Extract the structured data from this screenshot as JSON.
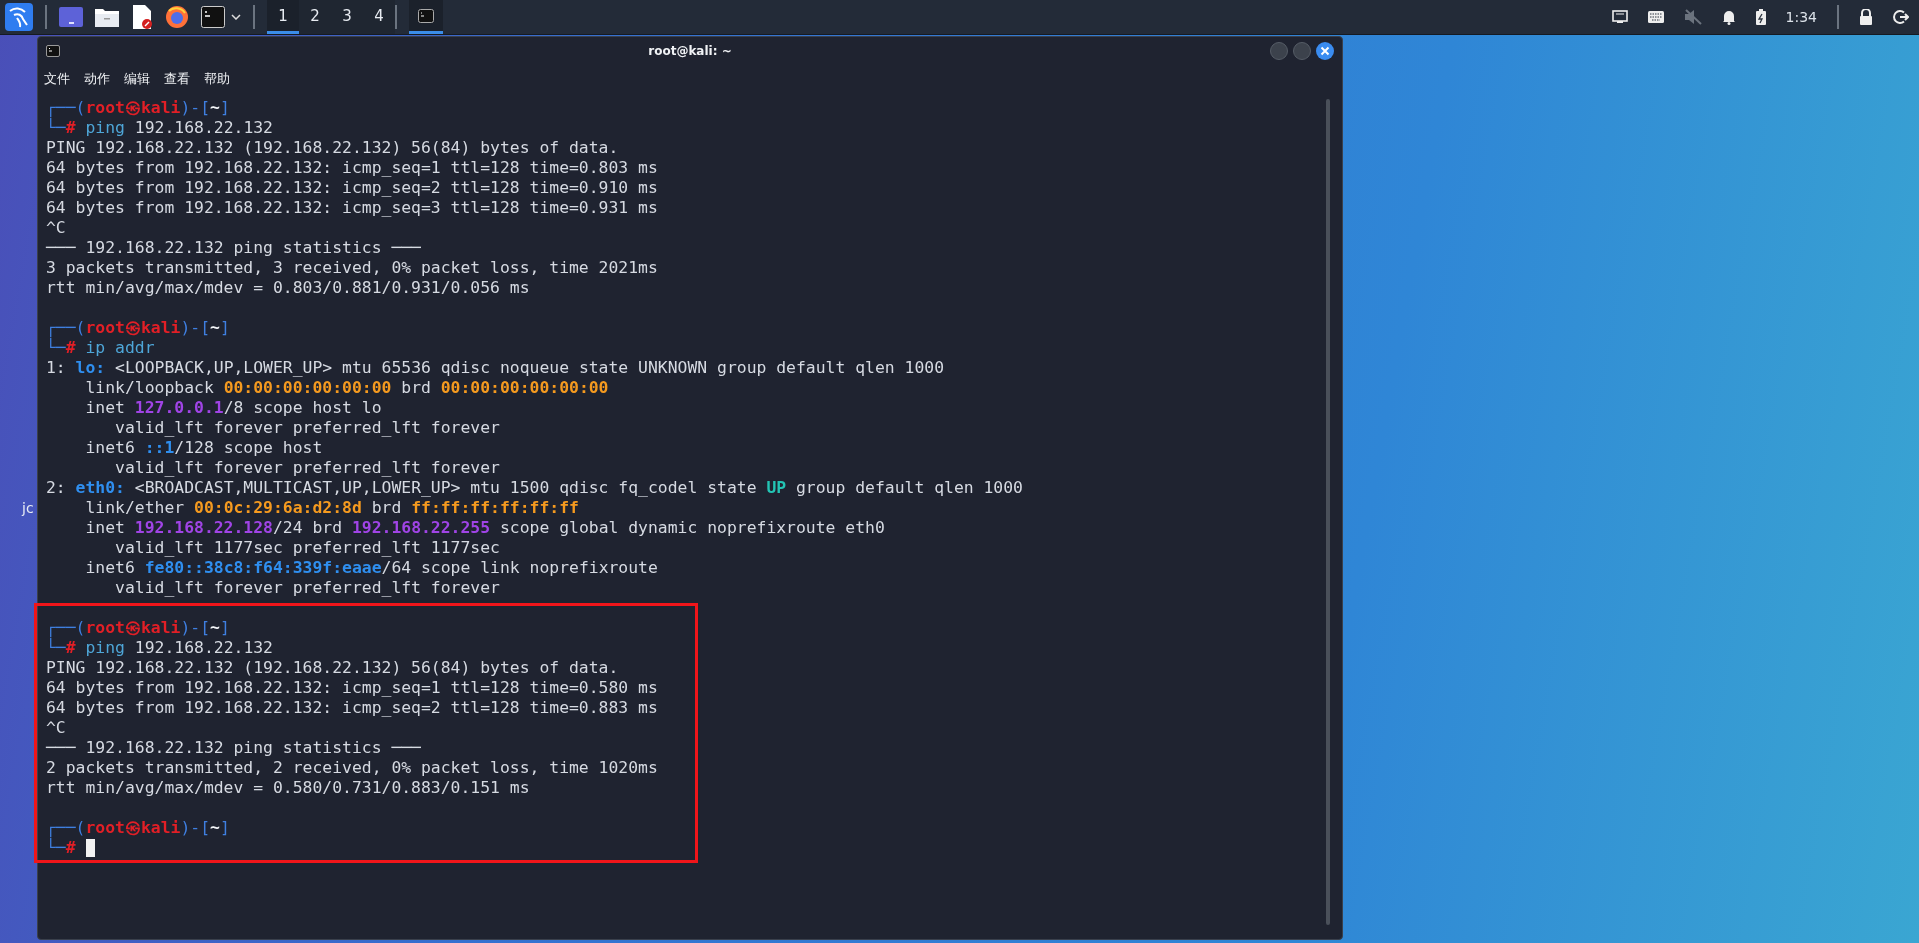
{
  "taskbar": {
    "workspaces": [
      {
        "label": "1",
        "selected": true
      },
      {
        "label": "2",
        "selected": false
      },
      {
        "label": "3",
        "selected": false
      },
      {
        "label": "4",
        "selected": false
      }
    ],
    "tasks": [
      {
        "kind": "terminal",
        "selected": true
      }
    ],
    "sound": {
      "muted": true
    },
    "clock": "1:34"
  },
  "desktop": {
    "icon_labels": [
      "jc"
    ]
  },
  "window": {
    "title": "root@kali: ~",
    "menu": [
      "文件",
      "动作",
      "编辑",
      "查看",
      "帮助"
    ]
  },
  "terminal": {
    "sections": [
      {
        "highlighted": false,
        "blocks": [
          {
            "lines": [
              [
                {
                  "kind": "frame",
                  "text": "┌──("
                },
                {
                  "kind": "host",
                  "text": "root㉿kali"
                },
                {
                  "kind": "frame",
                  "text": ")-["
                },
                {
                  "kind": "dir",
                  "text": "~"
                },
                {
                  "kind": "frame",
                  "text": "]"
                }
              ],
              [
                {
                  "kind": "frame",
                  "text": "└─"
                },
                {
                  "kind": "hash",
                  "text": "#"
                },
                {
                  "kind": "cmd",
                  "text": " ping"
                },
                {
                  "kind": "plain",
                  "text": " 192.168.22.132"
                }
              ],
              [
                {
                  "kind": "plain",
                  "text": "PING 192.168.22.132 (192.168.22.132) 56(84) bytes of data."
                }
              ],
              [
                {
                  "kind": "plain",
                  "text": "64 bytes from 192.168.22.132: icmp_seq=1 ttl=128 time=0.803 ms"
                }
              ],
              [
                {
                  "kind": "plain",
                  "text": "64 bytes from 192.168.22.132: icmp_seq=2 ttl=128 time=0.910 ms"
                }
              ],
              [
                {
                  "kind": "plain",
                  "text": "64 bytes from 192.168.22.132: icmp_seq=3 ttl=128 time=0.931 ms"
                }
              ],
              [
                {
                  "kind": "plain",
                  "text": "^C"
                }
              ],
              [
                {
                  "kind": "plain",
                  "text": "─── 192.168.22.132 ping statistics ───"
                }
              ],
              [
                {
                  "kind": "plain",
                  "text": "3 packets transmitted, 3 received, 0% packet loss, time 2021ms"
                }
              ],
              [
                {
                  "kind": "plain",
                  "text": "rtt min/avg/max/mdev = 0.803/0.881/0.931/0.056 ms"
                }
              ]
            ]
          },
          {
            "lines": [
              [
                {
                  "kind": "frame",
                  "text": "┌──("
                },
                {
                  "kind": "host",
                  "text": "root㉿kali"
                },
                {
                  "kind": "frame",
                  "text": ")-["
                },
                {
                  "kind": "dir",
                  "text": "~"
                },
                {
                  "kind": "frame",
                  "text": "]"
                }
              ],
              [
                {
                  "kind": "frame",
                  "text": "└─"
                },
                {
                  "kind": "hash",
                  "text": "#"
                },
                {
                  "kind": "cmd",
                  "text": " ip addr"
                }
              ],
              [
                {
                  "kind": "plain",
                  "text": "1: "
                },
                {
                  "kind": "blue",
                  "text": "lo:"
                },
                {
                  "kind": "plain",
                  "text": " <LOOPBACK,UP,LOWER_UP> mtu 65536 qdisc noqueue state UNKNOWN group default qlen 1000"
                }
              ],
              [
                {
                  "kind": "plain",
                  "text": "    link/loopback "
                },
                {
                  "kind": "orange",
                  "text": "00:00:00:00:00:00"
                },
                {
                  "kind": "plain",
                  "text": " brd "
                },
                {
                  "kind": "orange",
                  "text": "00:00:00:00:00:00"
                }
              ],
              [
                {
                  "kind": "plain",
                  "text": "    inet "
                },
                {
                  "kind": "purple",
                  "text": "127.0.0.1"
                },
                {
                  "kind": "plain",
                  "text": "/8 scope host lo"
                }
              ],
              [
                {
                  "kind": "plain",
                  "text": "       valid_lft forever preferred_lft forever"
                }
              ],
              [
                {
                  "kind": "plain",
                  "text": "    inet6 "
                },
                {
                  "kind": "blue",
                  "text": "::1"
                },
                {
                  "kind": "plain",
                  "text": "/128 scope host"
                }
              ],
              [
                {
                  "kind": "plain",
                  "text": "       valid_lft forever preferred_lft forever"
                }
              ],
              [
                {
                  "kind": "plain",
                  "text": "2: "
                },
                {
                  "kind": "blue",
                  "text": "eth0:"
                },
                {
                  "kind": "plain",
                  "text": " <BROADCAST,MULTICAST,UP,LOWER_UP> mtu 1500 qdisc fq_codel state "
                },
                {
                  "kind": "green",
                  "text": "UP"
                },
                {
                  "kind": "plain",
                  "text": " group default qlen 1000"
                }
              ],
              [
                {
                  "kind": "plain",
                  "text": "    link/ether "
                },
                {
                  "kind": "orange",
                  "text": "00:0c:29:6a:d2:8d"
                },
                {
                  "kind": "plain",
                  "text": " brd "
                },
                {
                  "kind": "orange",
                  "text": "ff:ff:ff:ff:ff:ff"
                }
              ],
              [
                {
                  "kind": "plain",
                  "text": "    inet "
                },
                {
                  "kind": "purple",
                  "text": "192.168.22.128"
                },
                {
                  "kind": "plain",
                  "text": "/24 brd "
                },
                {
                  "kind": "purple",
                  "text": "192.168.22.255"
                },
                {
                  "kind": "plain",
                  "text": " scope global dynamic noprefixroute eth0"
                }
              ],
              [
                {
                  "kind": "plain",
                  "text": "       valid_lft 1177sec preferred_lft 1177sec"
                }
              ],
              [
                {
                  "kind": "plain",
                  "text": "    inet6 "
                },
                {
                  "kind": "blue",
                  "text": "fe80::38c8:f64:339f:eaae"
                },
                {
                  "kind": "plain",
                  "text": "/64 scope link noprefixroute"
                }
              ],
              [
                {
                  "kind": "plain",
                  "text": "       valid_lft forever preferred_lft forever"
                }
              ]
            ]
          }
        ]
      },
      {
        "highlighted": true,
        "blocks": [
          {
            "lines": [
              [
                {
                  "kind": "frame",
                  "text": "┌──("
                },
                {
                  "kind": "host",
                  "text": "root㉿kali"
                },
                {
                  "kind": "frame",
                  "text": ")-["
                },
                {
                  "kind": "dir",
                  "text": "~"
                },
                {
                  "kind": "frame",
                  "text": "]"
                }
              ],
              [
                {
                  "kind": "frame",
                  "text": "└─"
                },
                {
                  "kind": "hash",
                  "text": "#"
                },
                {
                  "kind": "cmd",
                  "text": " ping"
                },
                {
                  "kind": "plain",
                  "text": " 192.168.22.132"
                }
              ],
              [
                {
                  "kind": "plain",
                  "text": "PING 192.168.22.132 (192.168.22.132) 56(84) bytes of data."
                }
              ],
              [
                {
                  "kind": "plain",
                  "text": "64 bytes from 192.168.22.132: icmp_seq=1 ttl=128 time=0.580 ms"
                }
              ],
              [
                {
                  "kind": "plain",
                  "text": "64 bytes from 192.168.22.132: icmp_seq=2 ttl=128 time=0.883 ms"
                }
              ],
              [
                {
                  "kind": "plain",
                  "text": "^C"
                }
              ],
              [
                {
                  "kind": "plain",
                  "text": "─── 192.168.22.132 ping statistics ───"
                }
              ],
              [
                {
                  "kind": "plain",
                  "text": "2 packets transmitted, 2 received, 0% packet loss, time 1020ms"
                }
              ],
              [
                {
                  "kind": "plain",
                  "text": "rtt min/avg/max/mdev = 0.580/0.731/0.883/0.151 ms"
                }
              ]
            ]
          },
          {
            "cursor": true,
            "lines": [
              [
                {
                  "kind": "frame",
                  "text": "┌──("
                },
                {
                  "kind": "host",
                  "text": "root㉿kali"
                },
                {
                  "kind": "frame",
                  "text": ")-["
                },
                {
                  "kind": "dir",
                  "text": "~"
                },
                {
                  "kind": "frame",
                  "text": "]"
                }
              ],
              [
                {
                  "kind": "frame",
                  "text": "└─"
                },
                {
                  "kind": "hash",
                  "text": "#"
                }
              ]
            ]
          }
        ]
      }
    ]
  }
}
